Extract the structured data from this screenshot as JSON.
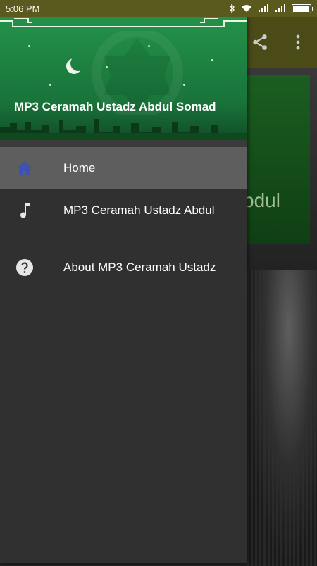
{
  "status_bar": {
    "time": "5:06 PM"
  },
  "background_app": {
    "visible_title_fragment": "bdul"
  },
  "drawer": {
    "header_title": "MP3 Ceramah Ustadz Abdul Somad",
    "items": [
      {
        "label": "Home",
        "icon": "home-icon",
        "active": true
      },
      {
        "label": "MP3 Ceramah Ustadz Abdul",
        "icon": "music-note-icon",
        "active": false
      },
      {
        "label": "About MP3 Ceramah Ustadz",
        "icon": "help-circle-icon",
        "active": false
      }
    ]
  },
  "colors": {
    "status_bar": "#5a5a1e",
    "toolbar": "#4b4b18",
    "drawer_bg": "#303030",
    "header_green": "#23924a",
    "active_item": "#5e5e5e",
    "home_icon": "#3f51b5"
  }
}
